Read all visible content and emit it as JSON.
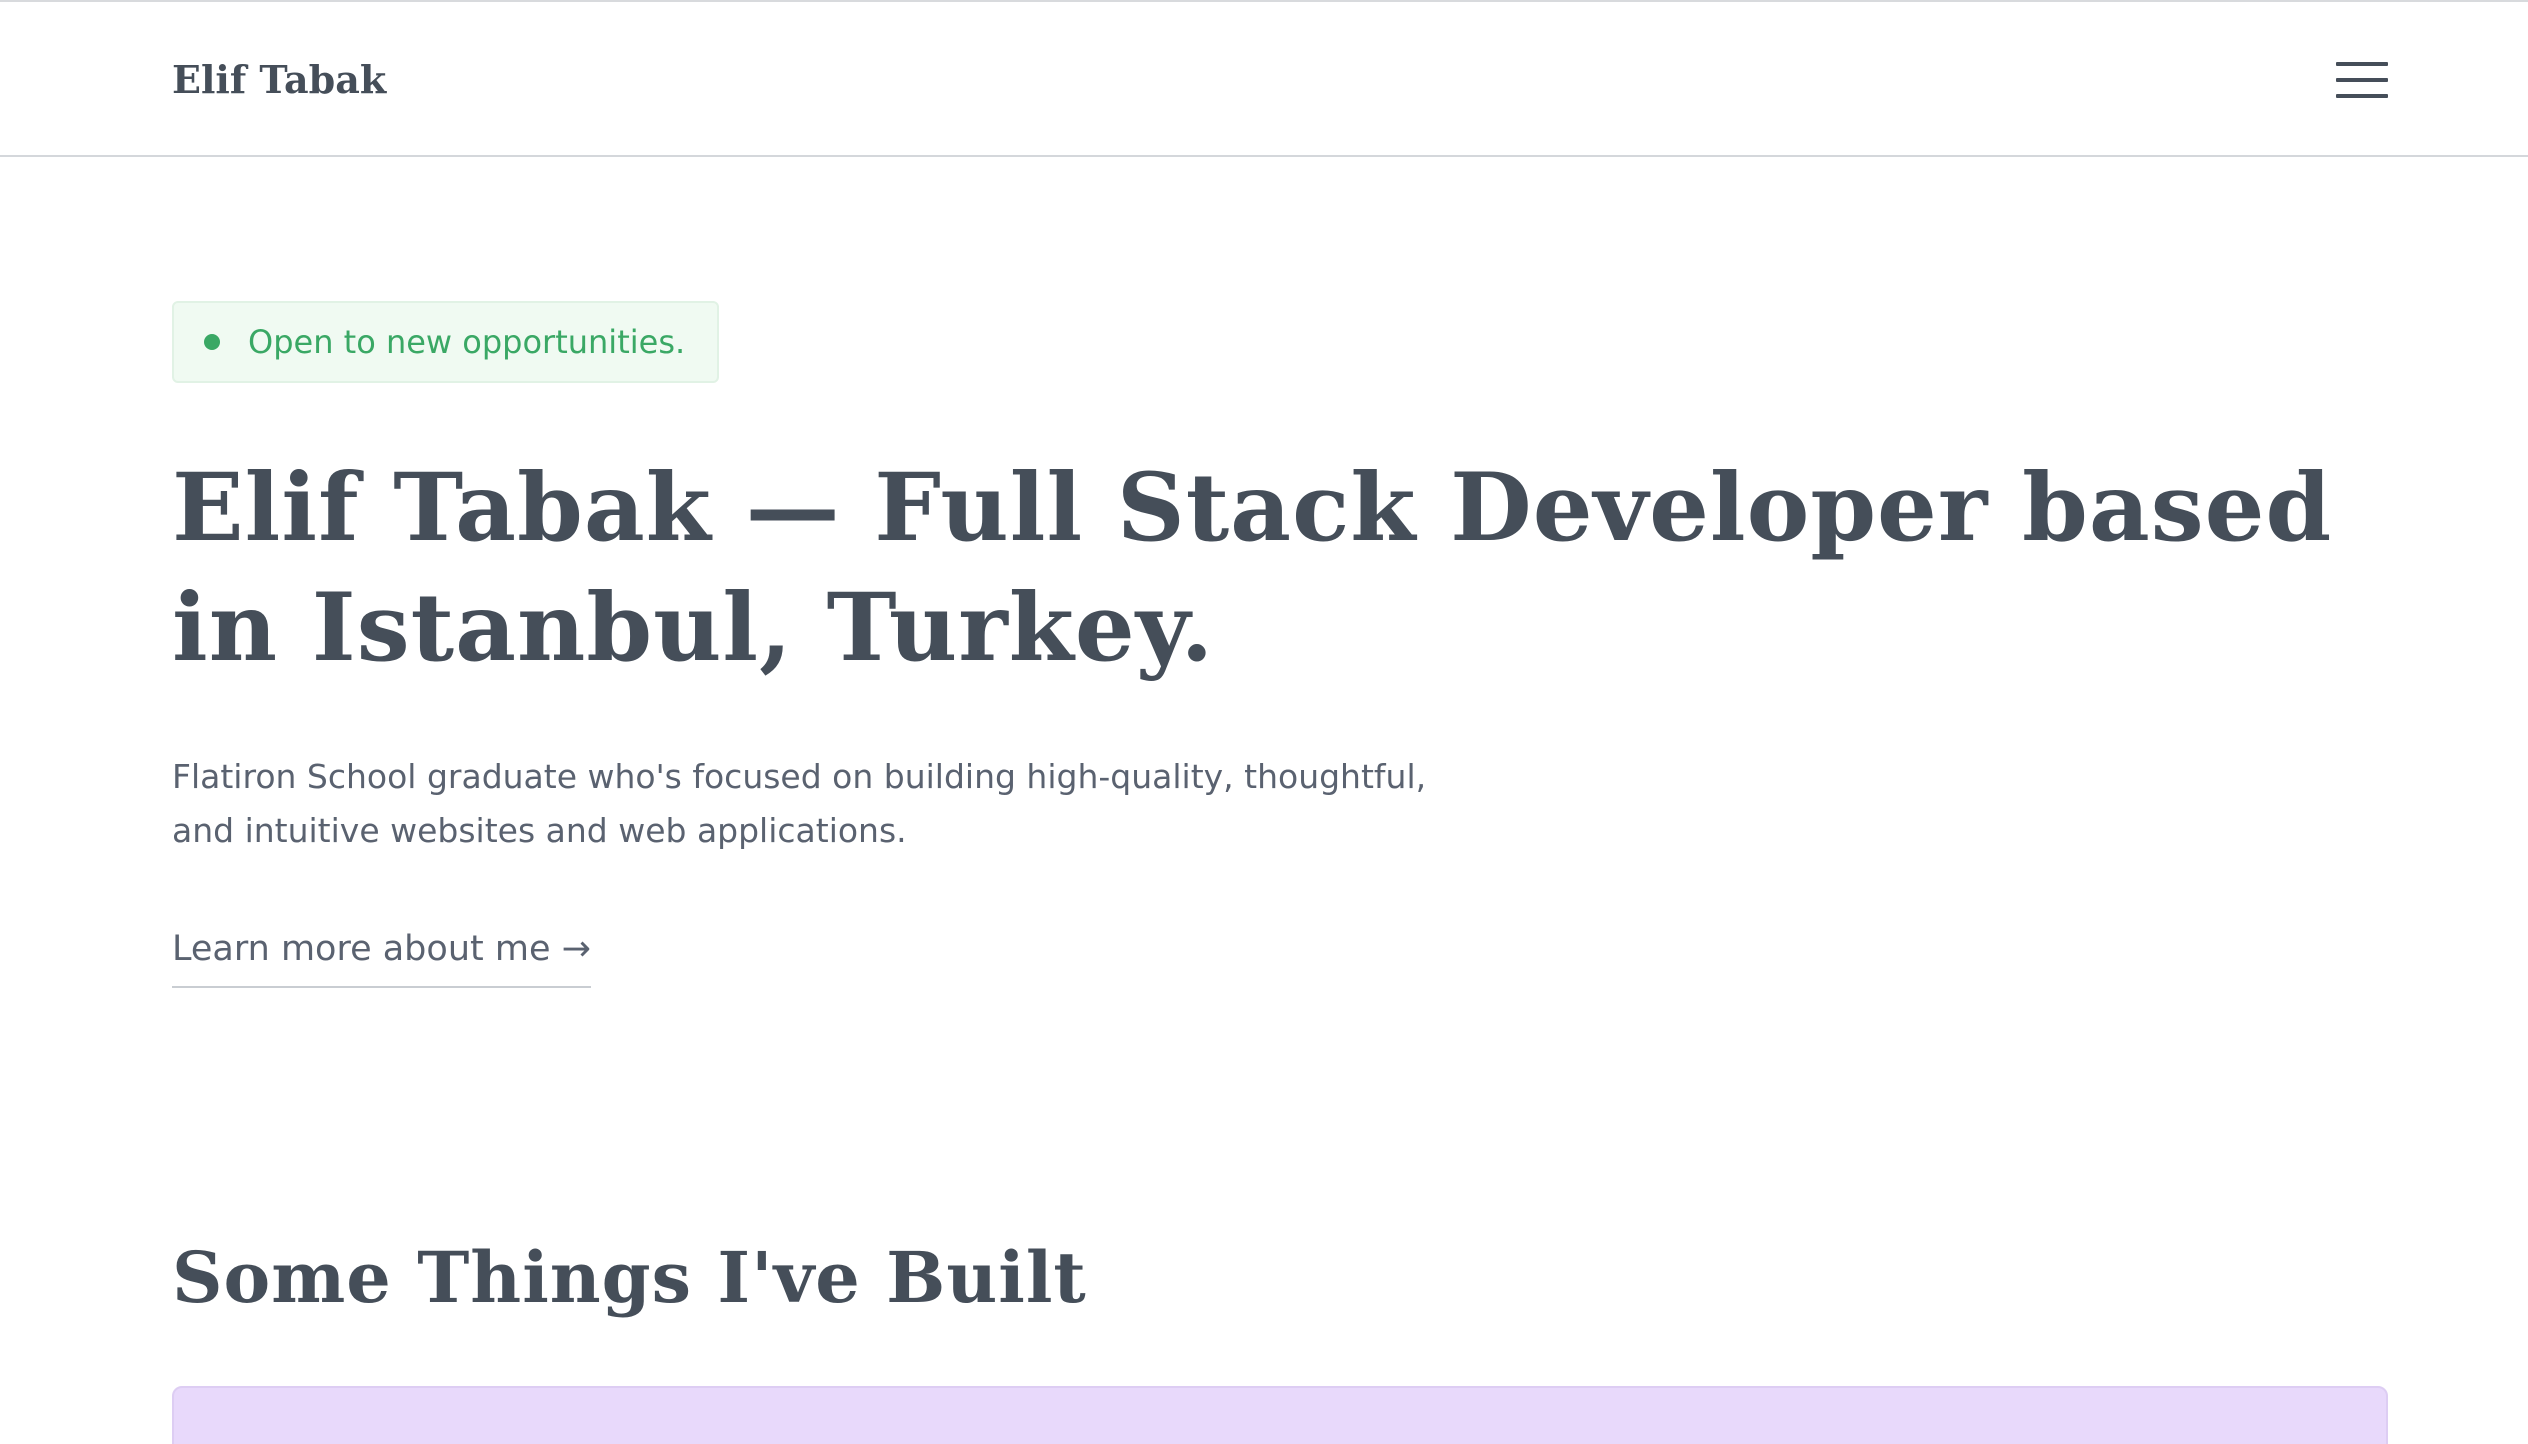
{
  "header": {
    "brand": "Elif Tabak",
    "menu_icon": "hamburger-menu-icon"
  },
  "hero": {
    "status_badge": "Open to new opportunities.",
    "status_color": "#3aa865",
    "title": "Elif Tabak — Full Stack Developer based in Istanbul, Turkey.",
    "intro": "Flatiron School graduate who's focused on building high-quality, thoughtful, and intuitive websites and web applications.",
    "cta_link": "Learn more about me →"
  },
  "projects": {
    "heading": "Some Things I've Built",
    "card_color": "#e8d9fb"
  },
  "colors": {
    "heading": "#454e59",
    "body_text": "#5a6270",
    "badge_bg": "#f0faf2"
  }
}
